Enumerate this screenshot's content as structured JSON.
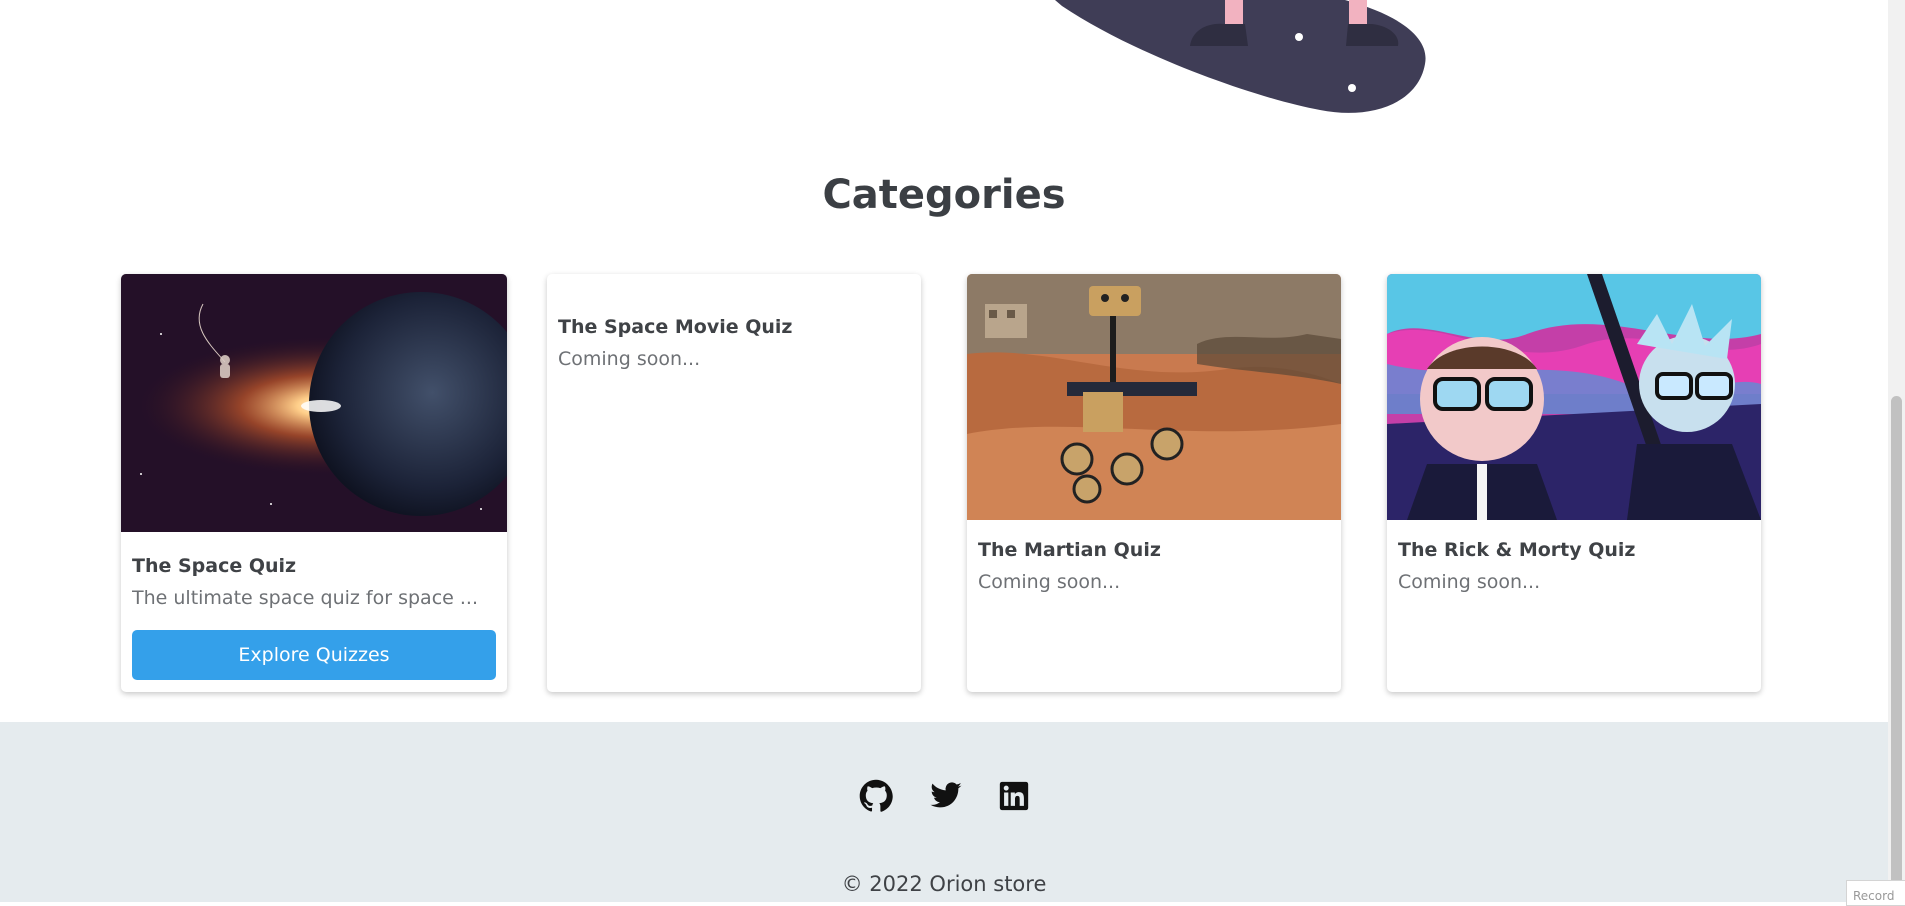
{
  "page": {
    "section_title": "Categories"
  },
  "categories": [
    {
      "title": "The Space Quiz",
      "description": "The ultimate space quiz for space ...",
      "button_label": "Explore Quizzes",
      "image": "earth-eclipse-astronaut"
    },
    {
      "title": "The Space Movie Quiz",
      "description": "Coming soon...",
      "image": "none"
    },
    {
      "title": "The Martian Quiz",
      "description": "Coming soon...",
      "image": "mars-rover-toy"
    },
    {
      "title": "The Rick & Morty Quiz",
      "description": "Coming soon...",
      "image": "rick-and-morty-cartoon"
    }
  ],
  "footer": {
    "social_icons": [
      "github-icon",
      "twitter-icon",
      "linkedin-icon"
    ],
    "copyright": "© 2022 Orion store"
  },
  "overlay": {
    "badge_text": "Record"
  },
  "colors": {
    "accent_button": "#34a0ea",
    "footer_bg": "#e5ebee",
    "heading": "#3b3f44",
    "illustration_dark": "#3f3d56",
    "illustration_pink": "#f2b2c0"
  }
}
